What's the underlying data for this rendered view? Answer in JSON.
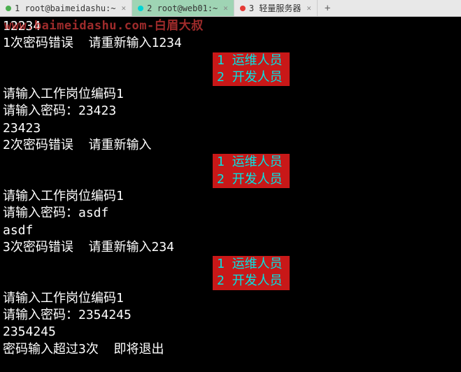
{
  "tabs": [
    {
      "label": "1 root@baimeidashu:~",
      "dot": "green",
      "active": false
    },
    {
      "label": "2 root@web01:~",
      "dot": "cyan",
      "active": true
    },
    {
      "label": "3 轻量服务器",
      "dot": "red",
      "active": false
    }
  ],
  "watermark": "www.baimeidashu.com-白眉大叔",
  "menu": {
    "opt1_num": "1",
    "opt1_label": "运维人员",
    "opt2_num": "2",
    "opt2_label": "开发人员"
  },
  "lines": {
    "l01": "12234",
    "l02": "1次密码错误  请重新输入1234",
    "l03": "请输入工作岗位编码1",
    "l04": "请输入密码：23423",
    "l05": "23423",
    "l06": "2次密码错误  请重新输入",
    "l07": "请输入工作岗位编码1",
    "l08": "请输入密码：asdf",
    "l09": "asdf",
    "l10": "3次密码错误  请重新输入234",
    "l11": "请输入工作岗位编码1",
    "l12": "请输入密码：2354245",
    "l13": "2354245",
    "l14": "密码输入超过3次  即将退出"
  }
}
